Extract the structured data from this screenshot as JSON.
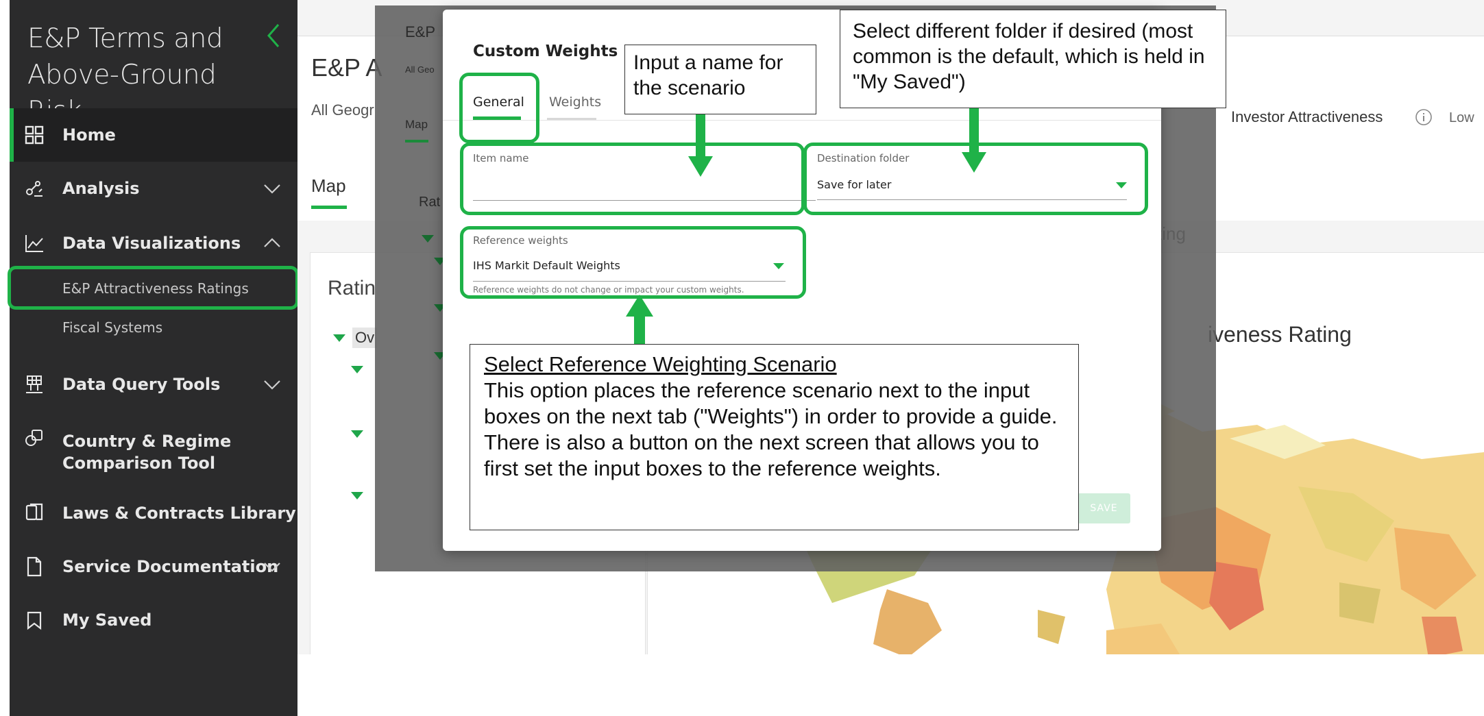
{
  "sidebar": {
    "app_title": "E&P Terms and Above-Ground Risk",
    "items": [
      {
        "label": "Home",
        "icon": "grid-icon"
      },
      {
        "label": "Analysis",
        "icon": "analysis-icon"
      },
      {
        "label": "Data Visualizations",
        "icon": "line-chart-icon"
      },
      {
        "label": "E&P Attractiveness Ratings"
      },
      {
        "label": "Fiscal Systems"
      },
      {
        "label": "Data Query Tools",
        "icon": "query-icon"
      },
      {
        "label": "Country & Regime Comparison Tool",
        "icon": "compare-icon"
      },
      {
        "label": "Laws & Contracts Library",
        "icon": "copy-icon"
      },
      {
        "label": "Service Documentation",
        "icon": "document-icon"
      },
      {
        "label": "My Saved",
        "icon": "bookmark-icon"
      }
    ]
  },
  "background": {
    "title": "E&P A",
    "geo": "All Geogr",
    "map_tab": "Map",
    "investor_label": "Investor Attractiveness",
    "low_label": "Low",
    "left_card_title": "Ratin",
    "left_card_item": "Ov",
    "rating_title": "iveness Rating",
    "rating_small": "ting"
  },
  "overlay": {
    "title": "E&P",
    "geo": "All Geo",
    "map_tab": "Map",
    "card_title": "Rat"
  },
  "modal": {
    "title": "Custom Weights",
    "tabs": [
      "General",
      "Weights"
    ],
    "item_name_label": "Item name",
    "item_name_value": "",
    "destination_label": "Destination folder",
    "destination_value": "Save for later",
    "reference_label": "Reference weights",
    "reference_value": "IHS Markit Default Weights",
    "reference_help": "Reference weights do not change or impact your custom weights.",
    "save_label": "SAVE"
  },
  "annotations": {
    "name": "Input a name for the scenario",
    "folder": "Select different folder if desired (most common is the default, which is held in \"My Saved\")",
    "ref_title": "Select Reference Weighting Scenario",
    "ref_body": "This option places the reference scenario next to the input boxes on the next tab (\"Weights\") in order to provide a guide. There is also a button on the next screen that allows you to first set the input boxes to the reference weights."
  },
  "colors": {
    "accent": "#1fb248",
    "sidebar_bg": "#2b2b2c",
    "sidebar_active": "#202021"
  }
}
